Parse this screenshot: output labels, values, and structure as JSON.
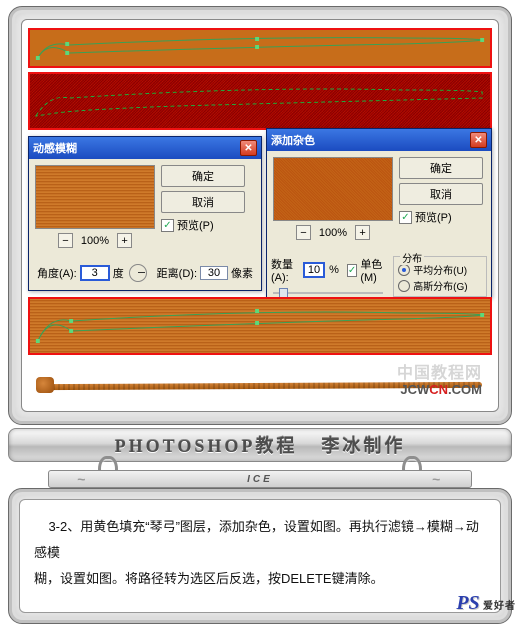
{
  "dialogs": {
    "motion_blur": {
      "title": "动感模糊",
      "ok": "确定",
      "cancel": "取消",
      "preview_label": "预览(P)",
      "zoom": "100%",
      "angle_label": "角度(A):",
      "angle_value": "3",
      "angle_unit": "度",
      "distance_label": "距离(D):",
      "distance_value": "30",
      "distance_unit": "像素"
    },
    "add_noise": {
      "title": "添加杂色",
      "ok": "确定",
      "cancel": "取消",
      "preview_label": "预览(P)",
      "zoom": "100%",
      "amount_label": "数量(A):",
      "amount_value": "10",
      "amount_unit": "%",
      "mono_label": "单色(M)",
      "dist_legend": "分布",
      "dist_uniform": "平均分布(U)",
      "dist_gaussian": "高斯分布(G)"
    }
  },
  "watermark": {
    "line1": "中国教程网",
    "brand_a": "JCW",
    "brand_b": "CN",
    "brand_c": ".COM"
  },
  "title_band": {
    "left": "PHOTOSHOP教程",
    "right": "李冰制作"
  },
  "ice_label": "ICE",
  "instruction": {
    "step": "3-2、",
    "text1": "用黄色填充“琴弓”图层，添加杂色，设置如图。再执行滤镜→模糊→动感模",
    "text2": "糊，设置如图。将路径转为选区后反选，按DELETE键清除。"
  },
  "pslogo": {
    "big": "PS",
    "sub": "爱好者"
  }
}
